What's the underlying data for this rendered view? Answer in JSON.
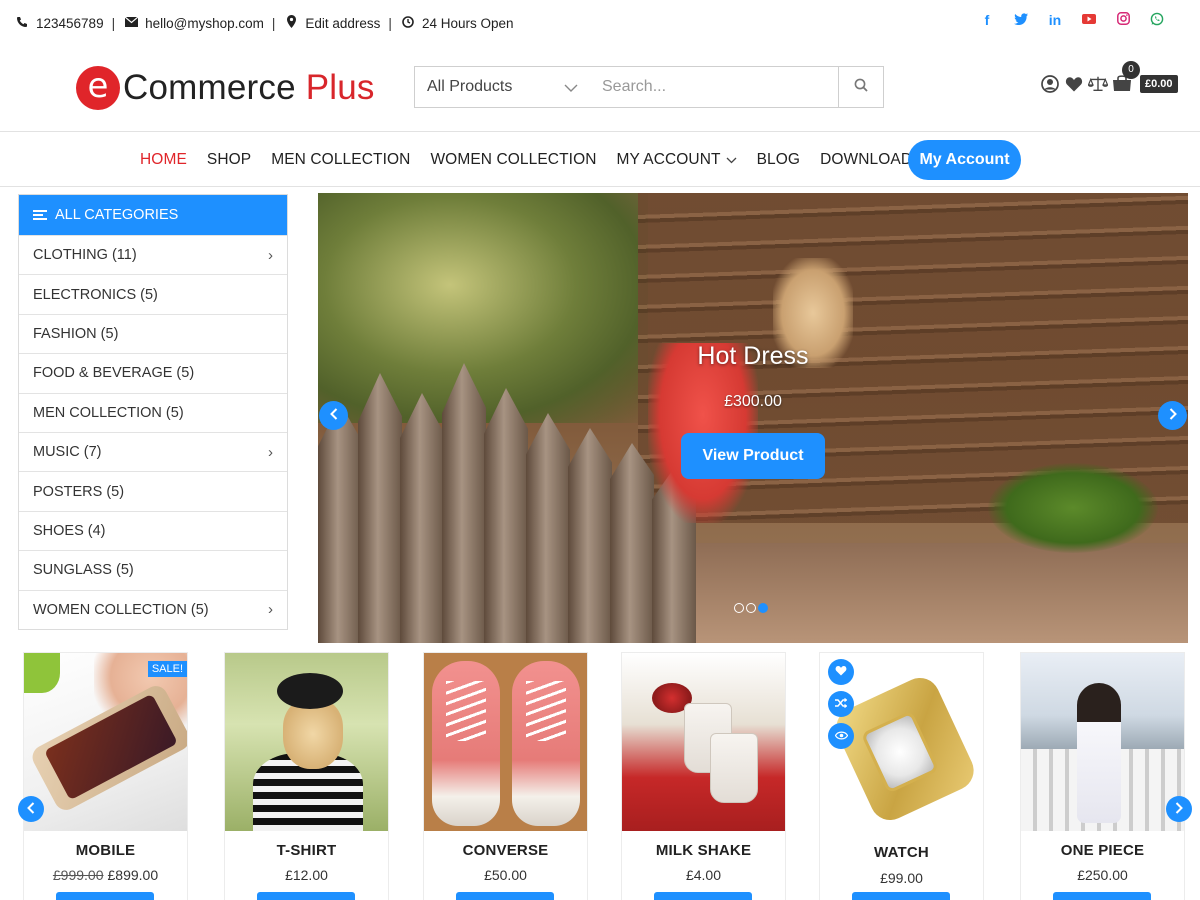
{
  "topbar": {
    "phone": "123456789",
    "email": "hello@myshop.com",
    "address": "Edit address",
    "hours": "24 Hours Open",
    "socials": [
      "facebook-icon",
      "twitter-icon",
      "linkedin-icon",
      "youtube-icon",
      "instagram-icon",
      "whatsapp-icon"
    ]
  },
  "logo": {
    "mark": "e",
    "text": "Commerce",
    "accent": "Plus"
  },
  "search": {
    "category": "All Products",
    "placeholder": "Search..."
  },
  "cart": {
    "count": "0",
    "total": "£0.00"
  },
  "nav": {
    "items": [
      "HOME",
      "SHOP",
      "MEN COLLECTION",
      "WOMEN COLLECTION",
      "MY ACCOUNT",
      "BLOG",
      "DOWNLOAD NOW"
    ],
    "active": "HOME",
    "account_button": "My Account"
  },
  "sidebar": {
    "title": "ALL CATEGORIES",
    "items": [
      {
        "label": "CLOTHING (11)",
        "has_children": true
      },
      {
        "label": "ELECTRONICS (5)",
        "has_children": false
      },
      {
        "label": "FASHION (5)",
        "has_children": false
      },
      {
        "label": "FOOD & BEVERAGE (5)",
        "has_children": false
      },
      {
        "label": "MEN COLLECTION (5)",
        "has_children": false
      },
      {
        "label": "MUSIC (7)",
        "has_children": true
      },
      {
        "label": "POSTERS (5)",
        "has_children": false
      },
      {
        "label": "SHOES (4)",
        "has_children": false
      },
      {
        "label": "SUNGLASS (5)",
        "has_children": false
      },
      {
        "label": "WOMEN COLLECTION (5)",
        "has_children": true
      }
    ]
  },
  "hero": {
    "title": "Hot Dress",
    "price": "£300.00",
    "button": "View Product",
    "slide_count": 3,
    "active_slide": 3
  },
  "products": [
    {
      "name": "MOBILE",
      "old_price": "£999.00",
      "price": "£899.00",
      "sale": "SALE!"
    },
    {
      "name": "T-SHIRT",
      "price": "£12.00"
    },
    {
      "name": "CONVERSE",
      "price": "£50.00"
    },
    {
      "name": "MILK SHAKE",
      "price": "£4.00"
    },
    {
      "name": "WATCH",
      "price": "£99.00"
    },
    {
      "name": "ONE PIECE",
      "price": "£250.00"
    }
  ],
  "colors": {
    "accent": "#1e90ff",
    "brand_red": "#e0252a"
  }
}
